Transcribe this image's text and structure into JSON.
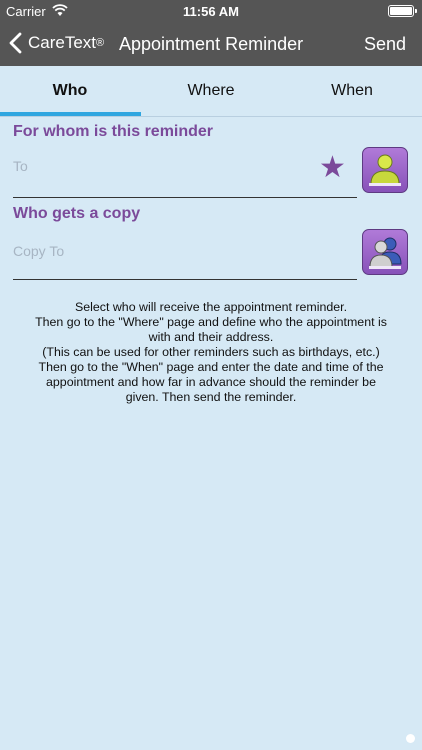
{
  "status_bar": {
    "carrier": "Carrier",
    "time": "11:56 AM"
  },
  "nav": {
    "back_label": "CareText",
    "back_label_mark": "®",
    "title": "Appointment Reminder",
    "send_label": "Send"
  },
  "tabs": [
    {
      "label": "Who",
      "active": true
    },
    {
      "label": "Where",
      "active": false
    },
    {
      "label": "When",
      "active": false
    }
  ],
  "who": {
    "recipient_heading": "For whom is this reminder",
    "to_placeholder": "To",
    "copy_heading": "Who gets a copy",
    "copy_placeholder": "Copy To"
  },
  "instructions": [
    "Select who will receive the appointment reminder.",
    "Then go to the \"Where\" page and define who the appointment is",
    "with and their address.",
    "(This can be used for other reminders such as birthdays, etc.)",
    "Then go to the \"When\" page and enter the date and time of the",
    "appointment and how far in advance should the reminder be",
    "given. Then send the reminder."
  ],
  "colors": {
    "nav_background": "#555555",
    "page_background": "#d6e9f5",
    "accent_purple": "#7b4a9a",
    "tab_indicator": "#2fa6e0"
  },
  "icons": {
    "back": "chevron-left-icon",
    "favorite": "star-icon",
    "single_contact": "person-icon",
    "group_contact": "people-icon"
  }
}
